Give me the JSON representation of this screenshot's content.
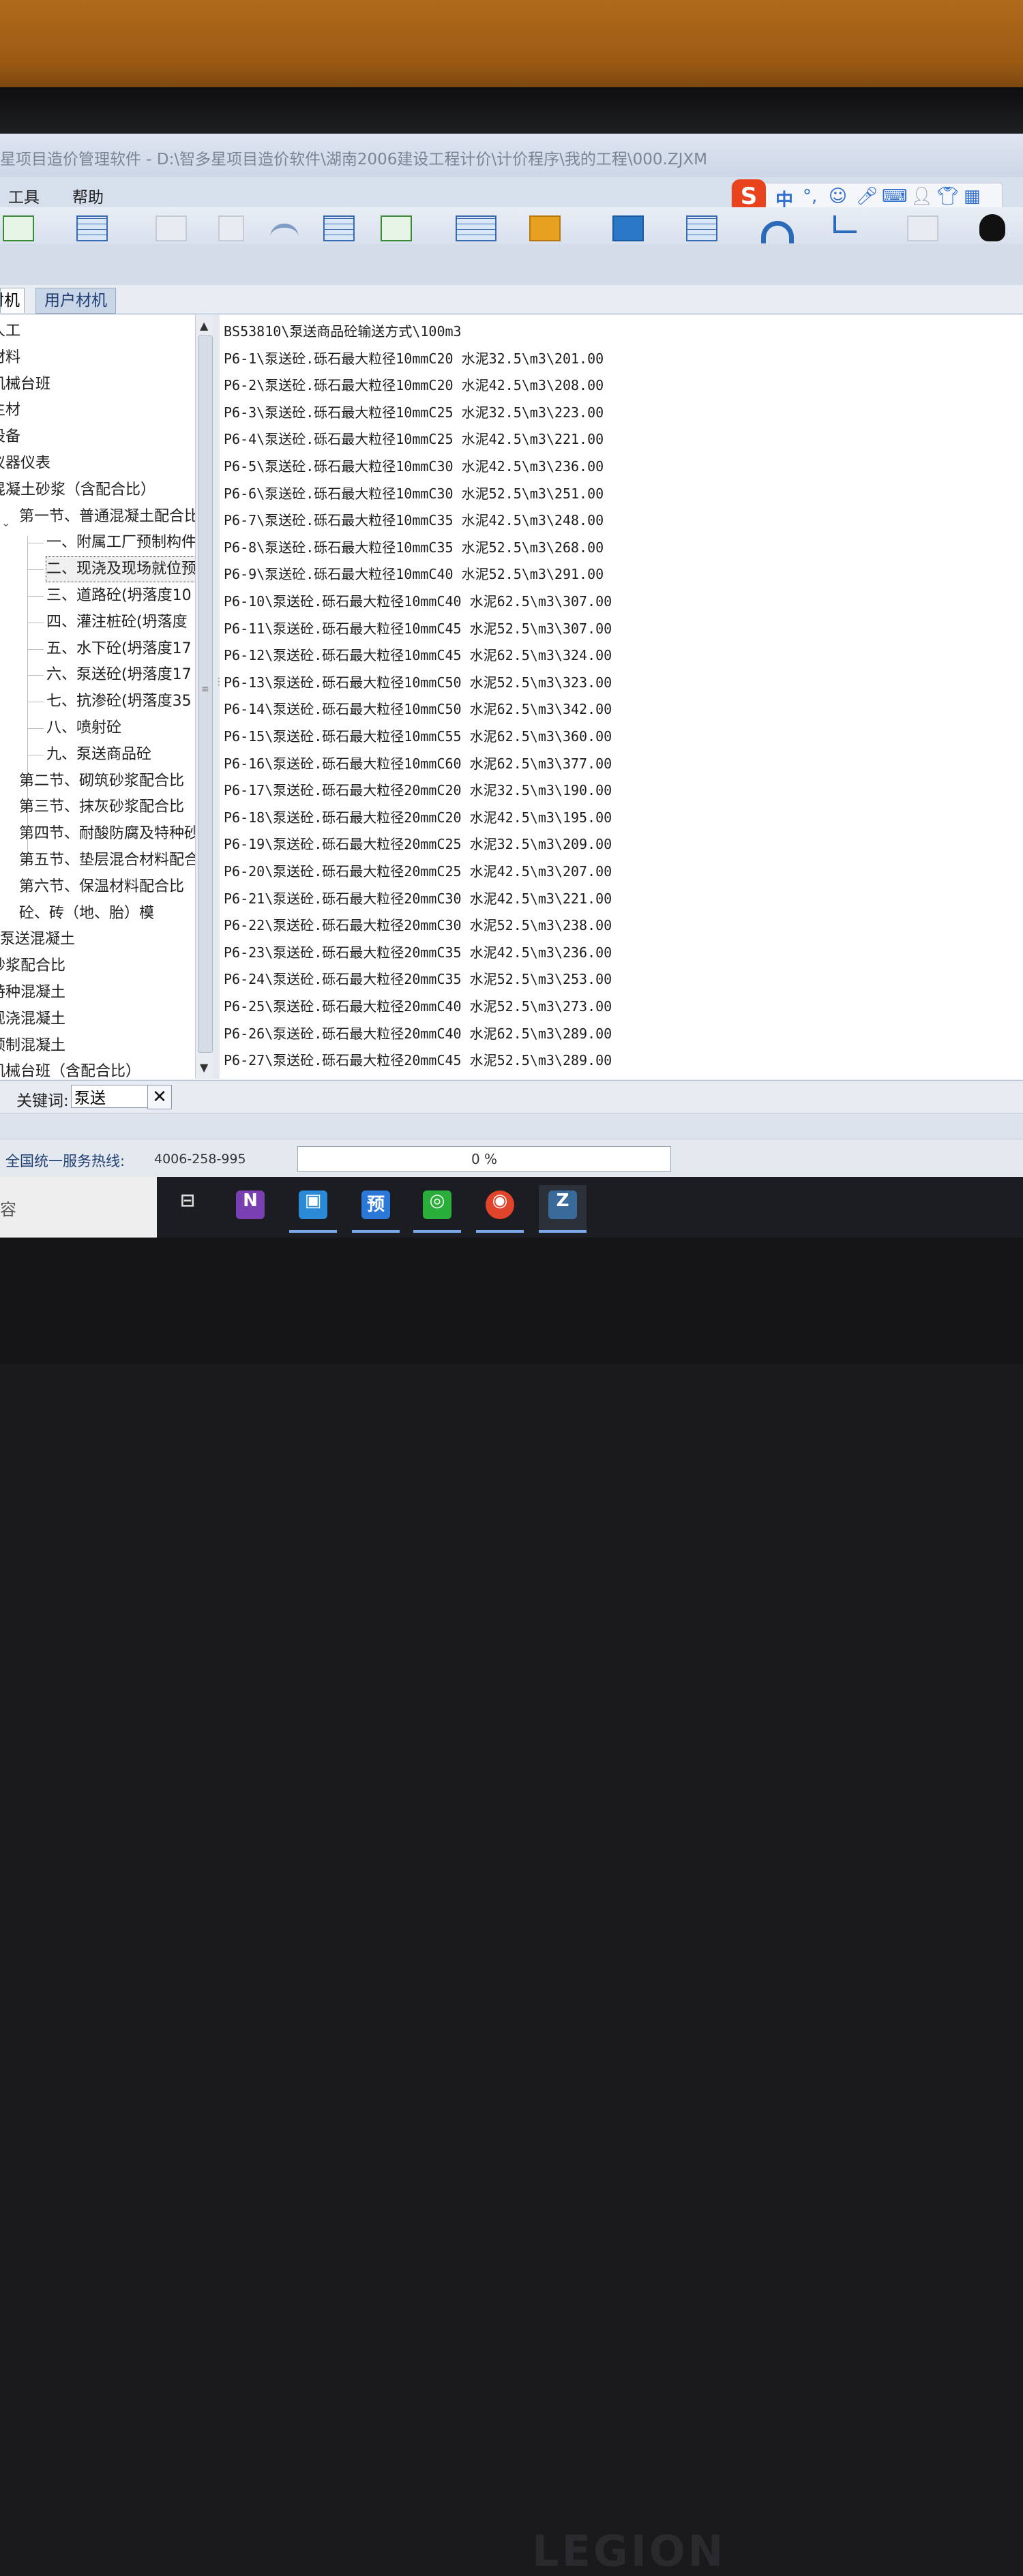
{
  "window": {
    "title": "星项目造价管理软件 - D:\\智多星项目造价软件\\湖南2006建设工程计价\\计价程序\\我的工程\\000.ZJXM"
  },
  "menu": {
    "items": [
      "工具",
      "帮助"
    ]
  },
  "ime": {
    "logo": "S",
    "mode": "中"
  },
  "tabs": [
    "材机",
    "用户材机"
  ],
  "tree": {
    "items": [
      {
        "label": "人工"
      },
      {
        "label": "材料"
      },
      {
        "label": "机械台班"
      },
      {
        "label": "主材"
      },
      {
        "label": "设备"
      },
      {
        "label": "仪器仪表"
      },
      {
        "label": "混凝土砂浆（含配合比）"
      },
      {
        "label": "第一节、普通混凝土配合比"
      },
      {
        "label": "一、附属工厂预制构件"
      },
      {
        "label": "二、现浇及现场就位预"
      },
      {
        "label": "三、道路砼(坍落度10"
      },
      {
        "label": "四、灌注桩砼(坍落度"
      },
      {
        "label": "五、水下砼(坍落度17"
      },
      {
        "label": "六、泵送砼(坍落度17"
      },
      {
        "label": "七、抗渗砼(坍落度35"
      },
      {
        "label": "八、喷射砼"
      },
      {
        "label": "九、泵送商品砼"
      },
      {
        "label": "第二节、砌筑砂浆配合比"
      },
      {
        "label": "第三节、抹灰砂浆配合比"
      },
      {
        "label": "第四节、耐酸防腐及特种砂"
      },
      {
        "label": "第五节、垫层混合材料配合"
      },
      {
        "label": "第六节、保温材料配合比"
      },
      {
        "label": "砼、砖（地、胎）模"
      },
      {
        "label": "泵送混凝土"
      },
      {
        "label": "砂浆配合比"
      },
      {
        "label": "特种混凝土"
      },
      {
        "label": "现浇混凝土"
      },
      {
        "label": "预制混凝土"
      },
      {
        "label": "机械台班（含配合比）"
      }
    ]
  },
  "list": {
    "rows": [
      "BS53810\\泵送商品砼输送方式\\100m3",
      "P6-1\\泵送砼.砾石最大粒径10mmC20 水泥32.5\\m3\\201.00",
      "P6-2\\泵送砼.砾石最大粒径10mmC20 水泥42.5\\m3\\208.00",
      "P6-3\\泵送砼.砾石最大粒径10mmC25 水泥32.5\\m3\\223.00",
      "P6-4\\泵送砼.砾石最大粒径10mmC25 水泥42.5\\m3\\221.00",
      "P6-5\\泵送砼.砾石最大粒径10mmC30 水泥42.5\\m3\\236.00",
      "P6-6\\泵送砼.砾石最大粒径10mmC30 水泥52.5\\m3\\251.00",
      "P6-7\\泵送砼.砾石最大粒径10mmC35 水泥42.5\\m3\\248.00",
      "P6-8\\泵送砼.砾石最大粒径10mmC35 水泥52.5\\m3\\268.00",
      "P6-9\\泵送砼.砾石最大粒径10mmC40 水泥52.5\\m3\\291.00",
      "P6-10\\泵送砼.砾石最大粒径10mmC40 水泥62.5\\m3\\307.00",
      "P6-11\\泵送砼.砾石最大粒径10mmC45 水泥52.5\\m3\\307.00",
      "P6-12\\泵送砼.砾石最大粒径10mmC45 水泥62.5\\m3\\324.00",
      "P6-13\\泵送砼.砾石最大粒径10mmC50 水泥52.5\\m3\\323.00",
      "P6-14\\泵送砼.砾石最大粒径10mmC50 水泥62.5\\m3\\342.00",
      "P6-15\\泵送砼.砾石最大粒径10mmC55 水泥62.5\\m3\\360.00",
      "P6-16\\泵送砼.砾石最大粒径10mmC60 水泥62.5\\m3\\377.00",
      "P6-17\\泵送砼.砾石最大粒径20mmC20 水泥32.5\\m3\\190.00",
      "P6-18\\泵送砼.砾石最大粒径20mmC20 水泥42.5\\m3\\195.00",
      "P6-19\\泵送砼.砾石最大粒径20mmC25 水泥32.5\\m3\\209.00",
      "P6-20\\泵送砼.砾石最大粒径20mmC25 水泥42.5\\m3\\207.00",
      "P6-21\\泵送砼.砾石最大粒径20mmC30 水泥42.5\\m3\\221.00",
      "P6-22\\泵送砼.砾石最大粒径20mmC30 水泥52.5\\m3\\238.00",
      "P6-23\\泵送砼.砾石最大粒径20mmC35 水泥42.5\\m3\\236.00",
      "P6-24\\泵送砼.砾石最大粒径20mmC35 水泥52.5\\m3\\253.00",
      "P6-25\\泵送砼.砾石最大粒径20mmC40 水泥52.5\\m3\\273.00",
      "P6-26\\泵送砼.砾石最大粒径20mmC40 水泥62.5\\m3\\289.00",
      "P6-27\\泵送砼.砾石最大粒径20mmC45 水泥52.5\\m3\\289.00",
      "P6-28\\泵送砼.砾石最大粒径20mmC45 水泥62.5\\m3\\305.00"
    ]
  },
  "keyword": {
    "label": "关键词:",
    "value": "泵送"
  },
  "status": {
    "hotline_label": "全国统一服务热线:",
    "hotline_number": "4006-258-995",
    "progress_text": "0 %",
    "progress_value": 0
  },
  "taskbar": {
    "search_char": "容",
    "apps": [
      {
        "name": "task-view",
        "glyph": "⊟"
      },
      {
        "name": "onenote",
        "glyph": "N"
      },
      {
        "name": "app-blue",
        "glyph": "▣"
      },
      {
        "name": "yu",
        "glyph": "预"
      },
      {
        "name": "wechat",
        "glyph": "◎"
      },
      {
        "name": "chrome",
        "glyph": "◉"
      },
      {
        "name": "zhiduoxing",
        "glyph": "Z"
      }
    ]
  },
  "device": {
    "brand": "LEGION"
  },
  "colors": {
    "accent": "#1f3e72",
    "progress": "#4cae4c",
    "ime_logo": "#e8431c"
  }
}
